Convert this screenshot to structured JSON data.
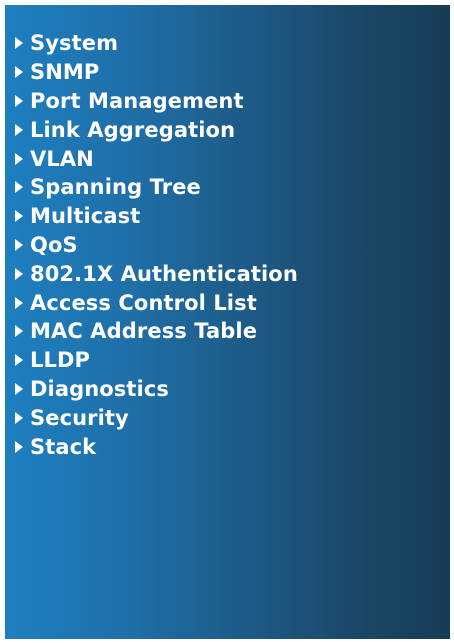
{
  "sidebar": {
    "background_colors": [
      "#1e7fc0",
      "#173c55"
    ],
    "arrow_icon": "caret-right-icon",
    "items": [
      {
        "label": "System"
      },
      {
        "label": "SNMP"
      },
      {
        "label": "Port Management"
      },
      {
        "label": "Link Aggregation"
      },
      {
        "label": "VLAN"
      },
      {
        "label": "Spanning Tree"
      },
      {
        "label": "Multicast"
      },
      {
        "label": "QoS"
      },
      {
        "label": "802.1X Authentication"
      },
      {
        "label": "Access Control List"
      },
      {
        "label": "MAC Address Table"
      },
      {
        "label": "LLDP"
      },
      {
        "label": "Diagnostics"
      },
      {
        "label": "Security"
      },
      {
        "label": "Stack"
      }
    ]
  }
}
